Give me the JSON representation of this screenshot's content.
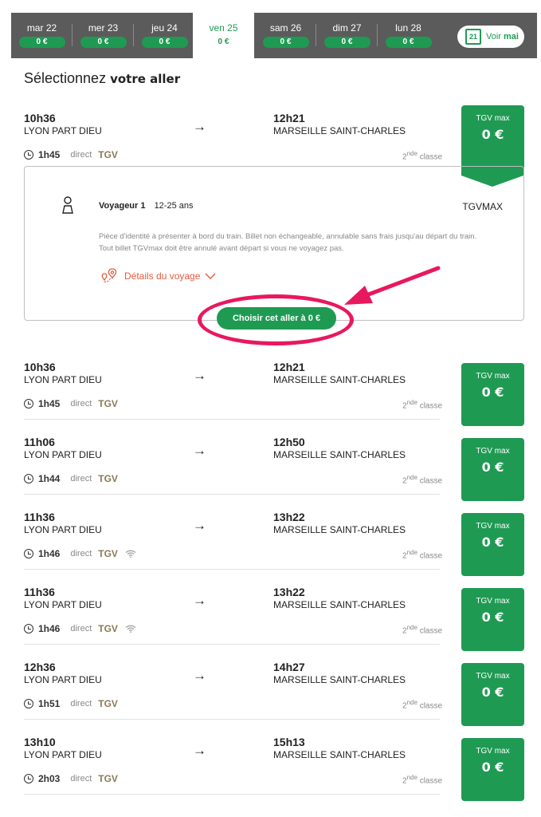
{
  "date_bar": {
    "days": [
      {
        "label": "mar 22",
        "price": "0 €",
        "active": false
      },
      {
        "label": "mer 23",
        "price": "0 €",
        "active": false
      },
      {
        "label": "jeu 24",
        "price": "0 €",
        "active": false
      },
      {
        "label": "ven 25",
        "price": "0 €",
        "active": true
      },
      {
        "label": "sam 26",
        "price": "0 €",
        "active": false
      },
      {
        "label": "dim 27",
        "price": "0 €",
        "active": false
      },
      {
        "label": "lun 28",
        "price": "0 €",
        "active": false
      }
    ],
    "calendar_day": "21",
    "voir_label": "Voir",
    "voir_month": "mai"
  },
  "heading": {
    "prefix": "Sélectionnez",
    "bold": "votre aller"
  },
  "trips": [
    {
      "dep_time": "10h36",
      "dep_station": "LYON PART DIEU",
      "arr_time": "12h21",
      "arr_station": "MARSEILLE SAINT-CHARLES",
      "duration": "1h45",
      "direct": "direct",
      "mode": "TGV",
      "wifi": false,
      "classe_sup": "nde",
      "classe_num": "2",
      "classe_label": "classe",
      "badge_title": "TGV max",
      "badge_price": "0 €"
    },
    {
      "dep_time": "10h36",
      "dep_station": "LYON PART DIEU",
      "arr_time": "12h21",
      "arr_station": "MARSEILLE SAINT-CHARLES",
      "duration": "1h45",
      "direct": "direct",
      "mode": "TGV",
      "wifi": false,
      "classe_sup": "nde",
      "classe_num": "2",
      "classe_label": "classe",
      "badge_title": "TGV max",
      "badge_price": "0 €"
    },
    {
      "dep_time": "11h06",
      "dep_station": "LYON PART DIEU",
      "arr_time": "12h50",
      "arr_station": "MARSEILLE SAINT-CHARLES",
      "duration": "1h44",
      "direct": "direct",
      "mode": "TGV",
      "wifi": false,
      "classe_sup": "nde",
      "classe_num": "2",
      "classe_label": "classe",
      "badge_title": "TGV max",
      "badge_price": "0 €"
    },
    {
      "dep_time": "11h36",
      "dep_station": "LYON PART DIEU",
      "arr_time": "13h22",
      "arr_station": "MARSEILLE SAINT-CHARLES",
      "duration": "1h46",
      "direct": "direct",
      "mode": "TGV",
      "wifi": true,
      "classe_sup": "nde",
      "classe_num": "2",
      "classe_label": "classe",
      "badge_title": "TGV max",
      "badge_price": "0 €"
    },
    {
      "dep_time": "11h36",
      "dep_station": "LYON PART DIEU",
      "arr_time": "13h22",
      "arr_station": "MARSEILLE SAINT-CHARLES",
      "duration": "1h46",
      "direct": "direct",
      "mode": "TGV",
      "wifi": true,
      "classe_sup": "nde",
      "classe_num": "2",
      "classe_label": "classe",
      "badge_title": "TGV max",
      "badge_price": "0 €"
    },
    {
      "dep_time": "12h36",
      "dep_station": "LYON PART DIEU",
      "arr_time": "14h27",
      "arr_station": "MARSEILLE SAINT-CHARLES",
      "duration": "1h51",
      "direct": "direct",
      "mode": "TGV",
      "wifi": false,
      "classe_sup": "nde",
      "classe_num": "2",
      "classe_label": "classe",
      "badge_title": "TGV max",
      "badge_price": "0 €"
    },
    {
      "dep_time": "13h10",
      "dep_station": "LYON PART DIEU",
      "arr_time": "15h13",
      "arr_station": "MARSEILLE SAINT-CHARLES",
      "duration": "2h03",
      "direct": "direct",
      "mode": "TGV",
      "wifi": false,
      "classe_sup": "nde",
      "classe_num": "2",
      "classe_label": "classe",
      "badge_title": "TGV max",
      "badge_price": "0 €"
    }
  ],
  "details": {
    "voyageur": "Voyageur 1",
    "age": "12-25 ans",
    "fare": "TGVMAX",
    "note_line1": "Pièce d'identité à présenter à bord du train. Billet non échangeable, annulable sans frais jusqu'au départ du train.",
    "note_line2": "Tout billet TGVmax doit être annulé avant départ si vous ne voyagez pas.",
    "link_label": "Détails du voyage",
    "choose_label": "Choisir cet aller à 0 €"
  },
  "colors": {
    "accent": "#1f9a53",
    "highlight": "#e8185e",
    "link": "#e35b3e"
  }
}
